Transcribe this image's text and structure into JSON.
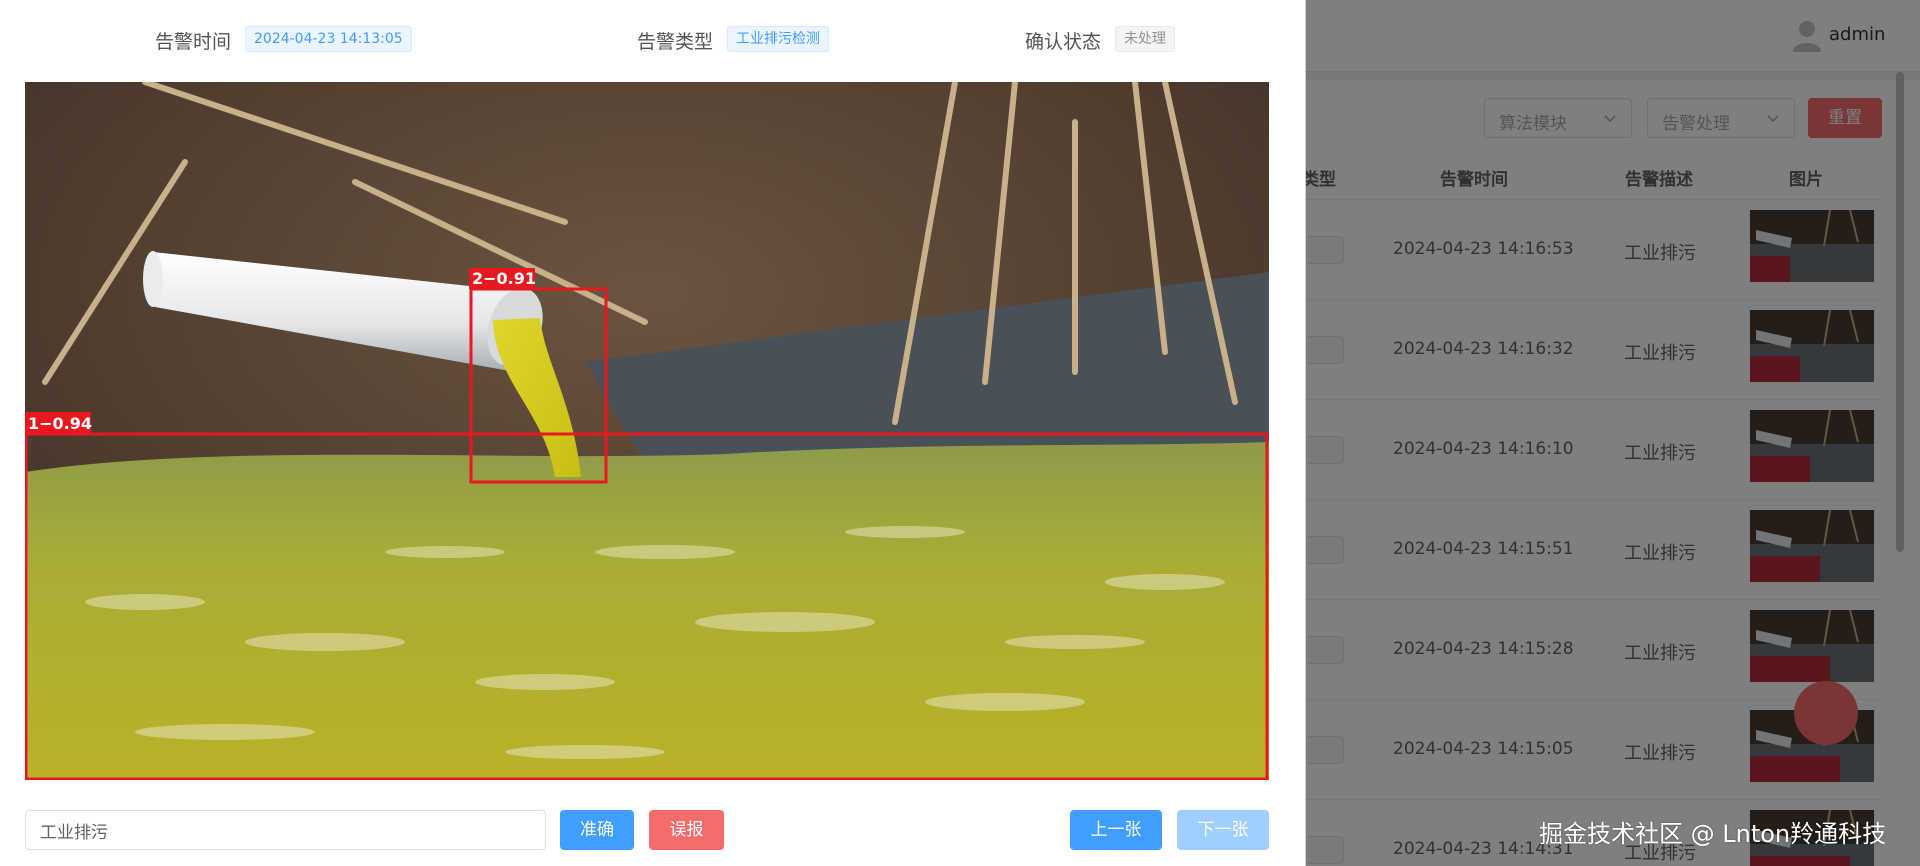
{
  "header": {
    "username": "admin",
    "filters": [
      {
        "placeholder": "算法模块"
      },
      {
        "placeholder": "告警处理"
      }
    ],
    "reset_label": "重置"
  },
  "table": {
    "columns": [
      "类型",
      "告警时间",
      "告警描述",
      "图片"
    ],
    "rows": [
      {
        "time": "2024-04-23 14:16:53",
        "desc": "工业排污"
      },
      {
        "time": "2024-04-23 14:16:32",
        "desc": "工业排污"
      },
      {
        "time": "2024-04-23 14:16:10",
        "desc": "工业排污"
      },
      {
        "time": "2024-04-23 14:15:51",
        "desc": "工业排污"
      },
      {
        "time": "2024-04-23 14:15:28",
        "desc": "工业排污"
      },
      {
        "time": "2024-04-23 14:15:05",
        "desc": "工业排污"
      },
      {
        "time": "2024-04-23 14:14:31",
        "desc": "工业排污"
      }
    ]
  },
  "dialog": {
    "alarm_time_label": "告警时间",
    "alarm_time_value": "2024-04-23 14:13:05",
    "alarm_type_label": "告警类型",
    "alarm_type_value": "工业排污检测",
    "confirm_status_label": "确认状态",
    "confirm_status_value": "未处理",
    "detections": [
      {
        "label": "1−0.94"
      },
      {
        "label": "2−0.91"
      }
    ],
    "description_value": "工业排污",
    "accurate_label": "准确",
    "false_alarm_label": "误报",
    "prev_label": "上一张",
    "next_label": "下一张"
  },
  "watermark": "掘金技术社区 @ Lnton羚通科技",
  "colors": {
    "primary": "#409eff",
    "danger": "#f56c6c",
    "primary_light": "#a0cfff",
    "detection_box": "#e8181f"
  }
}
